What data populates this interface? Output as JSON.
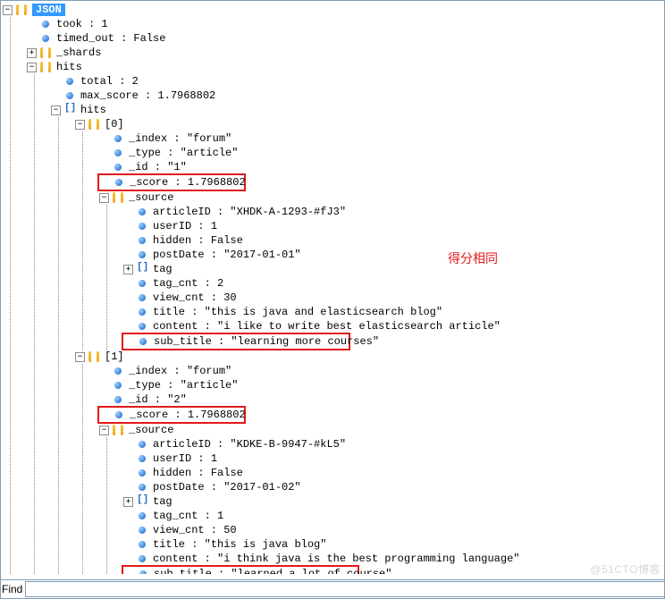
{
  "root": {
    "badge": "JSON"
  },
  "annotation": "得分相同",
  "watermark": "@51CTO博客",
  "find": {
    "label": "Find",
    "value": ""
  },
  "tree": {
    "took": {
      "k": "took",
      "v": "1"
    },
    "timed_out": {
      "k": "timed_out",
      "v": "False"
    },
    "shards": {
      "k": "_shards"
    },
    "hits": {
      "k": "hits",
      "total": {
        "k": "total",
        "v": "2"
      },
      "max_score": {
        "k": "max_score",
        "v": "1.7968802"
      },
      "hits_arr": {
        "k": "hits"
      },
      "items": [
        {
          "idx": "[0]",
          "_index": {
            "k": "_index",
            "v": "\"forum\""
          },
          "_type": {
            "k": "_type",
            "v": "\"article\""
          },
          "_id": {
            "k": "_id",
            "v": "\"1\""
          },
          "_score": {
            "k": "_score",
            "v": "1.7968802"
          },
          "_source": {
            "k": "_source",
            "articleID": {
              "k": "articleID",
              "v": "\"XHDK-A-1293-#fJ3\""
            },
            "userID": {
              "k": "userID",
              "v": "1"
            },
            "hidden": {
              "k": "hidden",
              "v": "False"
            },
            "postDate": {
              "k": "postDate",
              "v": "\"2017-01-01\""
            },
            "tag": {
              "k": "tag"
            },
            "tag_cnt": {
              "k": "tag_cnt",
              "v": "2"
            },
            "view_cnt": {
              "k": "view_cnt",
              "v": "30"
            },
            "title": {
              "k": "title",
              "v": "\"this is java and elasticsearch blog\""
            },
            "content": {
              "k": "content",
              "v": "\"i like to write best elasticsearch article\""
            },
            "sub_title": {
              "k": "sub_title",
              "v": "\"learning more courses\""
            }
          }
        },
        {
          "idx": "[1]",
          "_index": {
            "k": "_index",
            "v": "\"forum\""
          },
          "_type": {
            "k": "_type",
            "v": "\"article\""
          },
          "_id": {
            "k": "_id",
            "v": "\"2\""
          },
          "_score": {
            "k": "_score",
            "v": "1.7968802"
          },
          "_source": {
            "k": "_source",
            "articleID": {
              "k": "articleID",
              "v": "\"KDKE-B-9947-#kL5\""
            },
            "userID": {
              "k": "userID",
              "v": "1"
            },
            "hidden": {
              "k": "hidden",
              "v": "False"
            },
            "postDate": {
              "k": "postDate",
              "v": "\"2017-01-02\""
            },
            "tag": {
              "k": "tag"
            },
            "tag_cnt": {
              "k": "tag_cnt",
              "v": "1"
            },
            "view_cnt": {
              "k": "view_cnt",
              "v": "50"
            },
            "title": {
              "k": "title",
              "v": "\"this is java blog\""
            },
            "content": {
              "k": "content",
              "v": "\"i think java is the best programming language\""
            },
            "sub_title": {
              "k": "sub_title",
              "v": "\"learned a lot of course\""
            }
          }
        }
      ]
    }
  }
}
